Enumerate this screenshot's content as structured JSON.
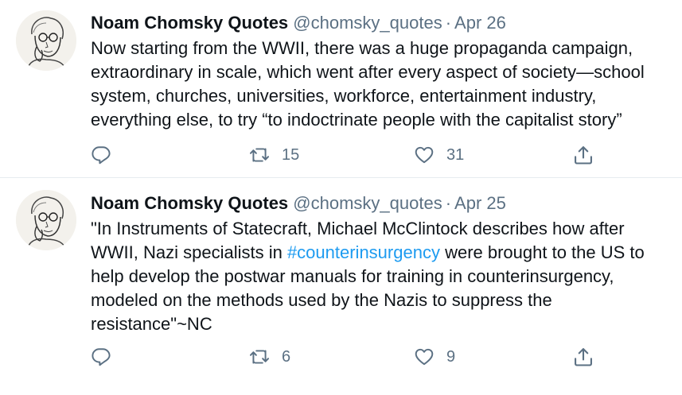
{
  "tweets": [
    {
      "author_name": "Noam Chomsky Quotes",
      "handle": "@chomsky_quotes",
      "separator": "·",
      "date": "Apr 26",
      "text": "Now starting from the WWII, there was a huge propaganda campaign, extraordinary in scale, which went after every aspect of society—school system, churches, universities, workforce, entertainment industry, everything else, to try “to indoctrinate people with the capitalist story”",
      "retweet_count": "15",
      "like_count": "31"
    },
    {
      "author_name": "Noam Chomsky Quotes",
      "handle": "@chomsky_quotes",
      "separator": "·",
      "date": "Apr 25",
      "text_before": "\"In Instruments of Statecraft, Michael McClintock describes how after WWII, Nazi specialists in ",
      "hashtag": "#counterinsurgency",
      "text_after": " were brought to the US to help develop the postwar manuals for training in counterinsurgency, modeled on the methods used by the Nazis to suppress the resistance\"~NC",
      "retweet_count": "6",
      "like_count": "9"
    }
  ],
  "icons": {
    "avatar": "portrait-sketch",
    "reply": "reply-icon",
    "retweet": "retweet-icon",
    "like": "heart-icon",
    "share": "share-icon"
  },
  "colors": {
    "text": "#0f1419",
    "secondary": "#5b7083",
    "hashtag": "#1d9bf0",
    "divider": "#e6ecf0"
  }
}
